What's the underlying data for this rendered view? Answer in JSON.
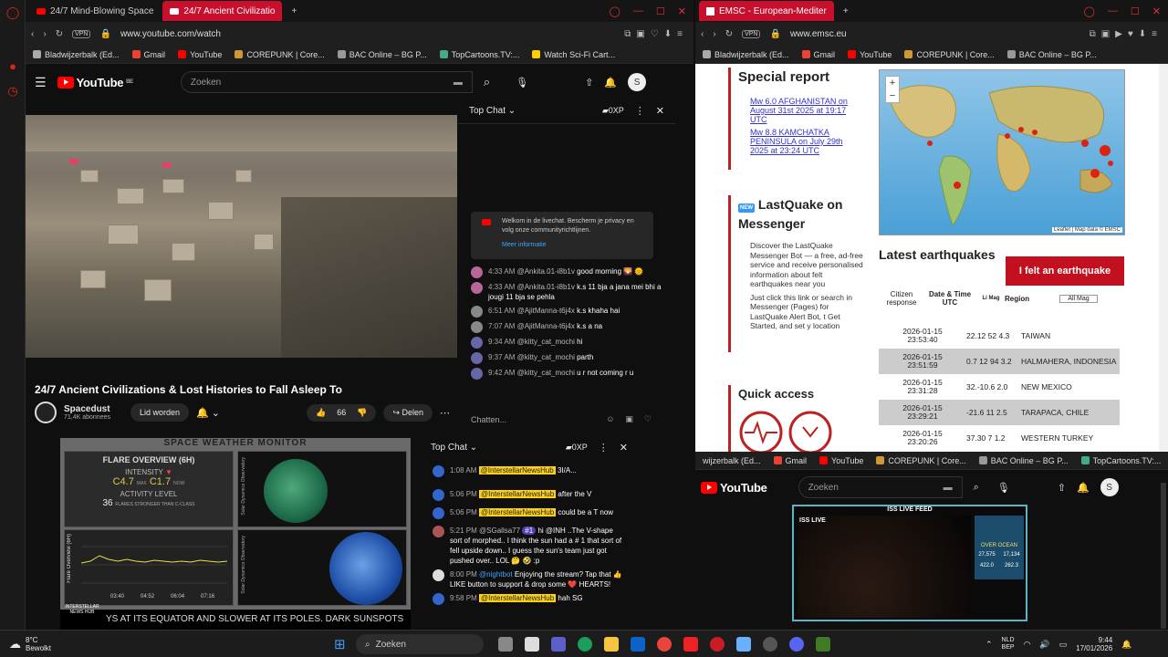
{
  "left_browser": {
    "tabs": [
      {
        "label": "24/7 Mind-Blowing Space"
      },
      {
        "label": "24/7 Ancient Civilizatio"
      }
    ],
    "url": "www.youtube.com/watch",
    "vpn": "VPN",
    "bookmarks": [
      "Bladwijzerbalk (Ed...",
      "Gmail",
      "YouTube",
      "COREPUNK | Core...",
      "BAC Online – BG P...",
      "TopCartoons.TV:...",
      "Watch Sci-Fi Cart..."
    ],
    "yt": {
      "logo": "YouTube",
      "region": "BE",
      "search_placeholder": "Zoeken",
      "avatar": "S",
      "video_title": "24/7 Ancient Civilizations & Lost Histories to Fall Asleep To",
      "channel": "Spacedust",
      "subscribers": "71,4K abonnees",
      "join": "Lid worden",
      "likes": "66",
      "share": "Delen"
    },
    "chat": {
      "header": "Top Chat",
      "points": "0XP",
      "welcome": "Welkom in de livechat. Bescherm je privacy en volg onze communityrichtlijnen.",
      "learn_more": "Meer informatie",
      "input_placeholder": "Chatten...",
      "messages": [
        {
          "time": "4:33 AM",
          "author": "@Ankita.01-i8b1v",
          "text": "good morning 🌄 🌞"
        },
        {
          "time": "4:33 AM",
          "author": "@Ankita.01-i8b1v",
          "text": "k.s 11 bja a jana mei bhi a jougi 11 bja se pehla"
        },
        {
          "time": "6:51 AM",
          "author": "@AjitManna-t6j4x",
          "text": "k.s khaha hai"
        },
        {
          "time": "7:07 AM",
          "author": "@AjitManna-t6j4x",
          "text": "k.s a na"
        },
        {
          "time": "9:34 AM",
          "author": "@kitty_cat_mochi",
          "text": "hi"
        },
        {
          "time": "9:37 AM",
          "author": "@kitty_cat_mochi",
          "text": "parth"
        },
        {
          "time": "9:42 AM",
          "author": "@kitty_cat_mochi",
          "text": "u r not coming r u"
        }
      ]
    }
  },
  "space_monitor": {
    "title": "SPACE WEATHER MONITOR",
    "flare_title": "FLARE OVERVIEW (6H)",
    "intensity_label": "INTENSITY",
    "max_value": "C4.7",
    "max_label": "MAX",
    "now_value": "C1.7",
    "now_label": "NOW",
    "activity_label": "ACTIVITY LEVEL",
    "activity_count": "36",
    "activity_desc": "FLARES STRONGER THAN C-CLASS",
    "side_label_1": "Solar Dynamics Observatory",
    "side_label_2": "Solar Dynamics Observatory",
    "chart_side_label": "Flare Overview (6H)",
    "chart_times": [
      "03:40",
      "04:52",
      "06:04",
      "07:16"
    ],
    "ticker": "YS AT ITS EQUATOR AND SLOWER AT ITS POLES.   DARK SUNSPOTS",
    "logo_text": "INTERSTELLAR NEWS HUB"
  },
  "bottom_chat": {
    "header": "Top Chat",
    "points": "0XP",
    "messages": [
      {
        "time": "1:08 AM",
        "author": "@InterstellarNewsHub",
        "text": "3I/A..."
      },
      {
        "time": "5:06 PM",
        "author": "@InterstellarNewsHub",
        "text": "after the V"
      },
      {
        "time": "5:06 PM",
        "author": "@InterstellarNewsHub",
        "text": "could be a T now"
      },
      {
        "time": "5:21 PM",
        "author": "@SGallsa77",
        "badge": "#1",
        "text": "hi @INH ..The V-shape sort of morphed.. I think the sun had a # 1 that sort of fell upside down.. I guess the sun's team just got pushed over.. LOL 🤔 🤣 :p"
      },
      {
        "time": "8:00 PM",
        "author": "@nightbot",
        "text": "Enjoying the stream? Tap that 👍 LIKE button to support & drop some ❤️ HEARTS!"
      },
      {
        "time": "9:58 PM",
        "author": "@InterstellarNewsHub",
        "text": "hah SG"
      }
    ]
  },
  "right_browser": {
    "tab": "EMSC - European-Mediter",
    "url": "www.emsc.eu",
    "bookmarks": [
      "Bladwijzerbalk (Ed...",
      "Gmail",
      "YouTube",
      "COREPUNK | Core...",
      "BAC Online – BG P..."
    ],
    "special_report_title": "Special report",
    "reports": [
      "Mw 6.0 AFGHANISTAN on August 31st 2025 at 19:17 UTC",
      "Mw 8.8 KAMCHATKA PENINSULA on July 29th 2025 at 23:24 UTC"
    ],
    "lastquake_title": "LastQuake on Messenger",
    "new_badge": "NEW",
    "lastquake_items": [
      "Discover the LastQuake Messenger Bot — a free, ad-free service and receive personalised information about felt earthquakes near you",
      "Just click this link or search in Messenger (Pages) for LastQuake Alert Bot, t Get Started, and set y location"
    ],
    "quick_access": "Quick access",
    "map_attrib": "Leaflet | Map data © EMSC",
    "latest_title": "Latest earthquakes",
    "felt_button": "I felt an earthquake",
    "col_citizen": "Citizen response",
    "col_date": "Date & Time UTC",
    "col_mag": "Li Mag",
    "col_region": "Region",
    "filter": "All Mag",
    "quakes": [
      {
        "date": "2026-01-15",
        "time": "23:53:40",
        "values": "22.12 52 4.3",
        "region": "TAIWAN"
      },
      {
        "date": "2026-01-15",
        "time": "23:51:59",
        "values": "0.7 12 94 3.2",
        "region": "HALMAHERA, INDONESIA"
      },
      {
        "date": "2026-01-15",
        "time": "23:31:28",
        "values": "32.-10.6 2.0",
        "region": "NEW MEXICO"
      },
      {
        "date": "2026-01-15",
        "time": "23:29:21",
        "values": "-21.6 11 2.5",
        "region": "TARAPACA, CHILE"
      },
      {
        "date": "2026-01-15",
        "time": "23:20:26",
        "values": "37.30 7 1.2",
        "region": "WESTERN TURKEY"
      }
    ]
  },
  "bottom_right": {
    "bookmarks": [
      "wijzerbalk (Ed...",
      "Gmail",
      "YouTube",
      "COREPUNK | Core...",
      "BAC Online – BG P...",
      "TopCartoons.TV:..."
    ],
    "logo": "YouTube",
    "search_placeholder": "Zoeken",
    "avatar": "S",
    "iss_title": "ISS LIVE FEED",
    "iss_label": "ISS LIVE",
    "over_ocean": "OVER OCEAN",
    "stat1": "27,575",
    "stat2": "17,134",
    "stat3": "422.0",
    "stat4": "262.3"
  },
  "taskbar": {
    "weather_temp": "8°C",
    "weather_desc": "Bewolkt",
    "search": "Zoeken",
    "lang": "NLD",
    "lang2": "BEP",
    "time": "9:44",
    "date": "17/01/2026"
  }
}
